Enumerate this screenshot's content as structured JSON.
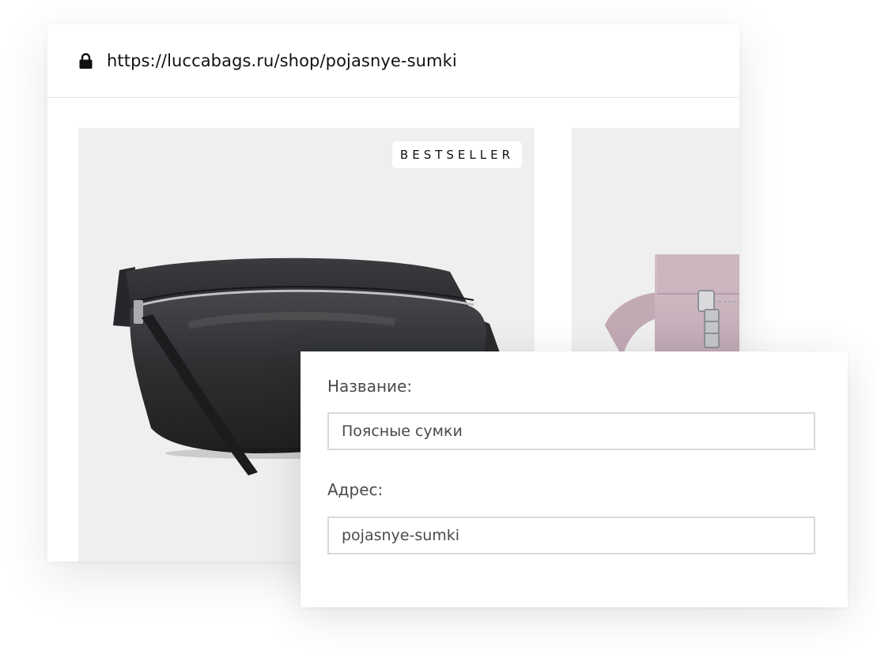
{
  "browser": {
    "url": "https://luccabags.ru/shop/pojasnye-sumki",
    "lock_icon": "lock-icon"
  },
  "products": [
    {
      "badge": "BESTSELLER",
      "image": "black-belt-bag",
      "color": "#2f3032"
    },
    {
      "image": "pink-belt-bag",
      "color": "#c9b3be"
    }
  ],
  "form": {
    "name_label": "Название:",
    "name_value": "Поясные сумки",
    "address_label": "Адрес:",
    "address_value": "pojasnye-sumki"
  },
  "colors": {
    "card_background": "#efefef",
    "border": "#d9d9d9",
    "text": "#111111"
  }
}
